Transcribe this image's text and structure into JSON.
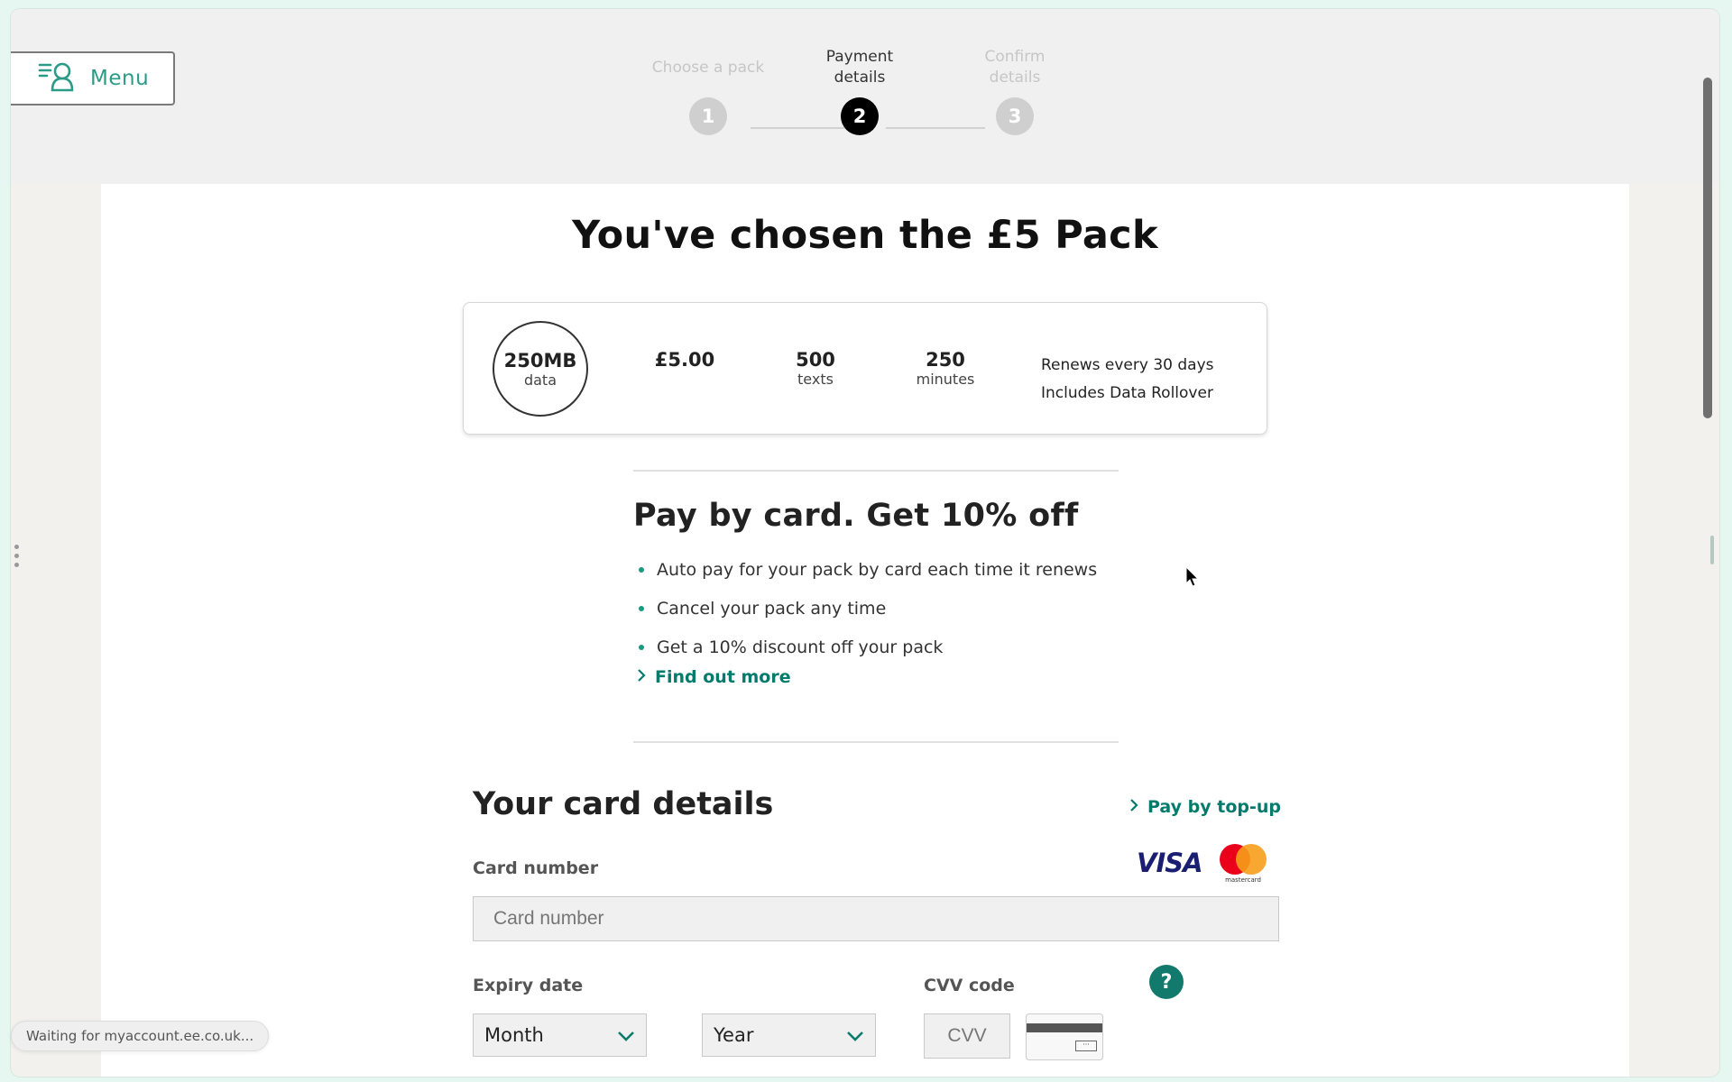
{
  "header": {
    "menu_label": "Menu",
    "steps": [
      {
        "number": "1",
        "label": "Choose a pack",
        "state": "inactive"
      },
      {
        "number": "2",
        "label": "Payment details",
        "state": "active"
      },
      {
        "number": "3",
        "label": "Confirm details",
        "state": "inactive"
      }
    ]
  },
  "page": {
    "title": "You've chosen the £5 Pack"
  },
  "pack": {
    "data_amount": "250MB",
    "data_label": "data",
    "price": "£5.00",
    "texts_amount": "500",
    "texts_label": "texts",
    "minutes_amount": "250",
    "minutes_label": "minutes",
    "renewal_note": "Renews every 30 days",
    "rollover_note": "Includes Data Rollover"
  },
  "promo": {
    "title": "Pay by card. Get 10% off",
    "bullets": [
      "Auto pay for your pack by card each time it renews",
      "Cancel your pack any time",
      "Get a 10% discount off your pack"
    ],
    "find_out_more": "Find out more"
  },
  "card_details": {
    "title": "Your card details",
    "pay_by_topup": "Pay by top-up",
    "card_number_label": "Card number",
    "card_number_placeholder": "Card number",
    "card_number_value": "",
    "visa_label": "VISA",
    "mastercard_label": "mastercard",
    "expiry_label": "Expiry date",
    "month_selected": "Month",
    "year_selected": "Year",
    "cvv_label": "CVV code",
    "cvv_placeholder": "CVV",
    "cvv_value": "",
    "help_glyph": "?",
    "cvv_card_dots": "···"
  },
  "browser": {
    "status_text": "Waiting for myaccount.ee.co.uk..."
  },
  "colors": {
    "brand_teal": "#007b6c",
    "bullet_teal": "#1a9a80",
    "help_button": "#117a6d",
    "step_active": "#000000",
    "step_inactive": "#cfcfcf"
  }
}
